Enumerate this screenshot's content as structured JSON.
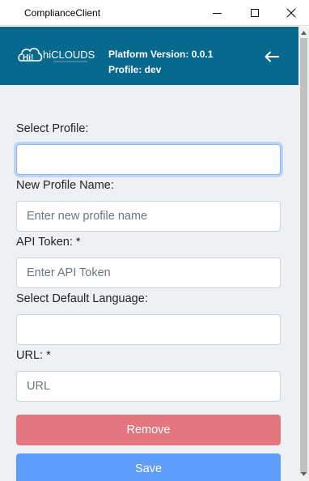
{
  "window": {
    "title": "ComplianceClient",
    "minimize_icon": "minimize-icon",
    "maximize_icon": "maximize-icon",
    "close_icon": "close-icon"
  },
  "header": {
    "logo_text": "hiCLOUDS",
    "platform_version": "Platform Version: 0.0.1",
    "profile": "Profile: dev",
    "back_icon": "arrow-left-icon",
    "background_color": "#08698f"
  },
  "form": {
    "select_profile": {
      "label": "Select Profile:",
      "value": ""
    },
    "new_profile_name": {
      "label": "New Profile Name:",
      "placeholder": "Enter new profile name"
    },
    "api_token": {
      "label": "API Token: *",
      "placeholder": "Enter API Token"
    },
    "default_language": {
      "label": "Select Default Language:",
      "value": ""
    },
    "url": {
      "label": "URL: *",
      "placeholder": "URL"
    }
  },
  "buttons": {
    "remove": {
      "label": "Remove",
      "color": "#e4767f"
    },
    "save": {
      "label": "Save",
      "color": "#5f9dfb"
    }
  }
}
